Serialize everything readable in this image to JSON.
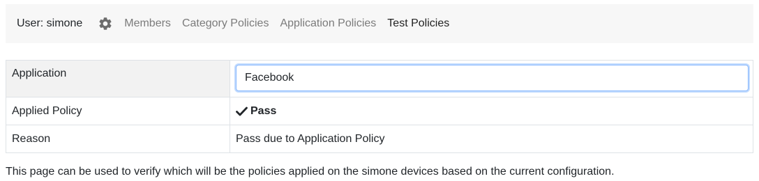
{
  "navbar": {
    "user_label": "User: simone",
    "settings_icon": "gear-icon",
    "links": {
      "members": "Members",
      "category_policies": "Category Policies",
      "application_policies": "Application Policies",
      "test_policies": "Test Policies"
    },
    "active_link": "Test Policies"
  },
  "table": {
    "application_label": "Application",
    "application_value": "Facebook",
    "applied_policy_label": "Applied Policy",
    "applied_policy_value": "Pass",
    "applied_policy_icon": "check-icon",
    "reason_label": "Reason",
    "reason_value": "Pass due to Application Policy"
  },
  "footer": {
    "note": "This page can be used to verify which will be the policies applied on the simone devices based on the current configuration."
  },
  "colors": {
    "navbar_bg": "#f7f7f7",
    "link_inactive": "#7b7b7b",
    "link_active": "#222222",
    "input_focus_border": "#86b7fe"
  }
}
